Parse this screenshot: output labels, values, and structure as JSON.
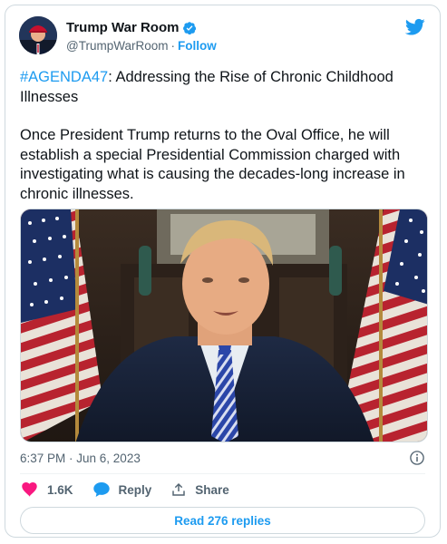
{
  "author": {
    "display_name": "Trump War Room",
    "handle": "@TrumpWarRoom",
    "separator": "·",
    "follow_label": "Follow"
  },
  "tweet": {
    "hashtag": "#AGENDA47",
    "headline_rest": ": Addressing the Rise of Chronic Childhood Illnesses",
    "body": "Once President Trump returns to the Oval Office, he will establish a special Presidential Commission charged with investigating what is causing the decades-long increase in chronic illnesses."
  },
  "meta": {
    "timestamp": "6:37 PM · Jun 6, 2023"
  },
  "actions": {
    "like_count": "1.6K",
    "reply_label": "Reply",
    "share_label": "Share"
  },
  "footer": {
    "read_replies_label": "Read 276 replies"
  },
  "icons": {
    "verified": "verified-badge-icon",
    "brand": "twitter-bird-icon",
    "info": "info-icon",
    "like": "heart-icon",
    "reply": "chat-bubble-icon",
    "share": "share-upload-icon"
  },
  "colors": {
    "accent": "#1d9bf0",
    "like": "#f91880",
    "text": "#0f1419",
    "muted": "#536471",
    "border": "#cfd9de"
  }
}
